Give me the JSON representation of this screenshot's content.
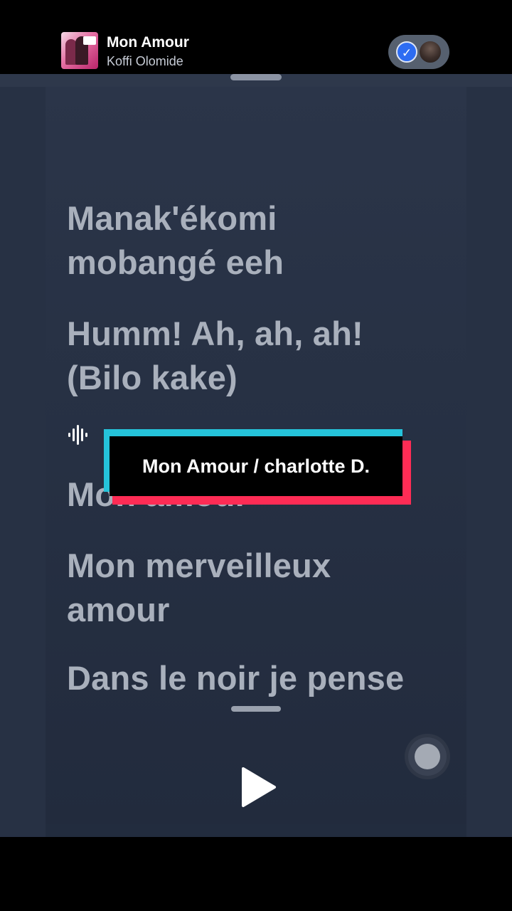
{
  "track": {
    "title": "Mon Amour",
    "artist": "Koffi Olomide"
  },
  "share": {
    "check_icon": "checkmark-icon",
    "avatar": "user-avatar"
  },
  "lyrics": {
    "line1": "Manak'ékomi",
    "line2": "mobangé eeh",
    "line3": "Humm! Ah, ah, ah!",
    "line4": "(Bilo kake)",
    "line5": "Mon amour",
    "line6": "Mon merveilleux",
    "line7": "amour",
    "line8": "Dans le noir je pense"
  },
  "caption": {
    "text": "Mon Amour / charlotte D."
  },
  "colors": {
    "accent_cyan": "#25c3da",
    "accent_red": "#fe2c55",
    "check_blue": "#2d6cf2",
    "lyric_text": "#a9b0bc"
  },
  "icons": [
    "waveform-icon",
    "play-icon",
    "record-icon"
  ]
}
